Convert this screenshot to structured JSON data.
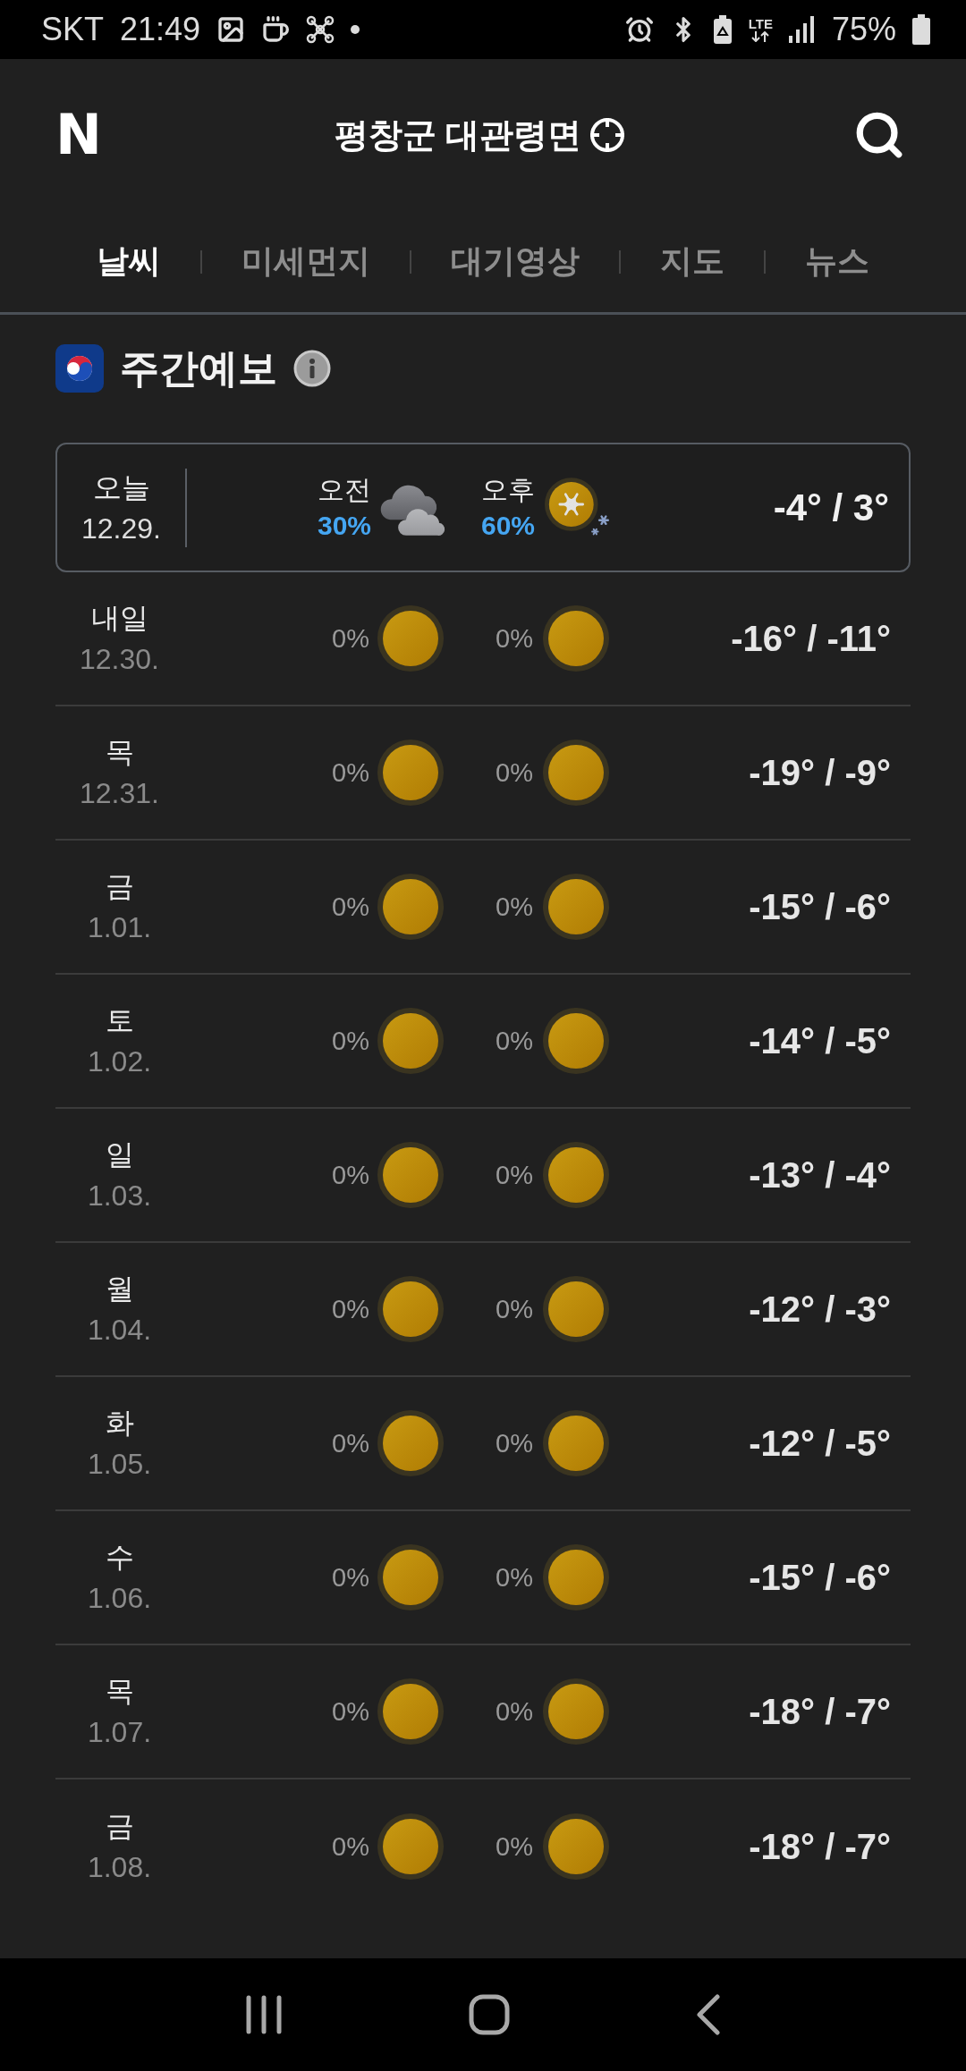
{
  "status_bar": {
    "carrier": "SKT",
    "time": "21:49",
    "network": "LTE",
    "battery": "75%"
  },
  "header": {
    "logo": "N",
    "title": "평창군 대관령면"
  },
  "tabs": [
    {
      "label": "날씨",
      "selected": true
    },
    {
      "label": "미세먼지",
      "selected": false
    },
    {
      "label": "대기영상",
      "selected": false
    },
    {
      "label": "지도",
      "selected": false
    },
    {
      "label": "뉴스",
      "selected": false
    }
  ],
  "section": {
    "title": "주간예보"
  },
  "today": {
    "day": "오늘",
    "date": "12.29.",
    "am": {
      "label": "오전",
      "precip": "30%",
      "kind": "cloudy"
    },
    "pm": {
      "label": "오후",
      "precip": "60%",
      "kind": "snow"
    },
    "temps": "-4° / 3°"
  },
  "days": [
    {
      "day": "내일",
      "date": "12.30.",
      "am": {
        "precip": "0%",
        "kind": "sunny"
      },
      "pm": {
        "precip": "0%",
        "kind": "sunny"
      },
      "temps": "-16° / -11°"
    },
    {
      "day": "목",
      "date": "12.31.",
      "am": {
        "precip": "0%",
        "kind": "sunny"
      },
      "pm": {
        "precip": "0%",
        "kind": "sunny"
      },
      "temps": "-19° / -9°"
    },
    {
      "day": "금",
      "date": "1.01.",
      "am": {
        "precip": "0%",
        "kind": "sunny"
      },
      "pm": {
        "precip": "0%",
        "kind": "sunny"
      },
      "temps": "-15° / -6°"
    },
    {
      "day": "토",
      "date": "1.02.",
      "am": {
        "precip": "0%",
        "kind": "sunny"
      },
      "pm": {
        "precip": "0%",
        "kind": "sunny"
      },
      "temps": "-14° / -5°"
    },
    {
      "day": "일",
      "date": "1.03.",
      "am": {
        "precip": "0%",
        "kind": "sunny"
      },
      "pm": {
        "precip": "0%",
        "kind": "sunny"
      },
      "temps": "-13° / -4°"
    },
    {
      "day": "월",
      "date": "1.04.",
      "am": {
        "precip": "0%",
        "kind": "sunny"
      },
      "pm": {
        "precip": "0%",
        "kind": "sunny"
      },
      "temps": "-12° / -3°"
    },
    {
      "day": "화",
      "date": "1.05.",
      "am": {
        "precip": "0%",
        "kind": "sunny"
      },
      "pm": {
        "precip": "0%",
        "kind": "sunny"
      },
      "temps": "-12° / -5°"
    },
    {
      "day": "수",
      "date": "1.06.",
      "am": {
        "precip": "0%",
        "kind": "sunny"
      },
      "pm": {
        "precip": "0%",
        "kind": "sunny"
      },
      "temps": "-15° / -6°"
    },
    {
      "day": "목",
      "date": "1.07.",
      "am": {
        "precip": "0%",
        "kind": "sunny"
      },
      "pm": {
        "precip": "0%",
        "kind": "sunny"
      },
      "temps": "-18° / -7°"
    },
    {
      "day": "금",
      "date": "1.08.",
      "am": {
        "precip": "0%",
        "kind": "sunny"
      },
      "pm": {
        "precip": "0%",
        "kind": "sunny"
      },
      "temps": "-18° / -7°"
    }
  ]
}
